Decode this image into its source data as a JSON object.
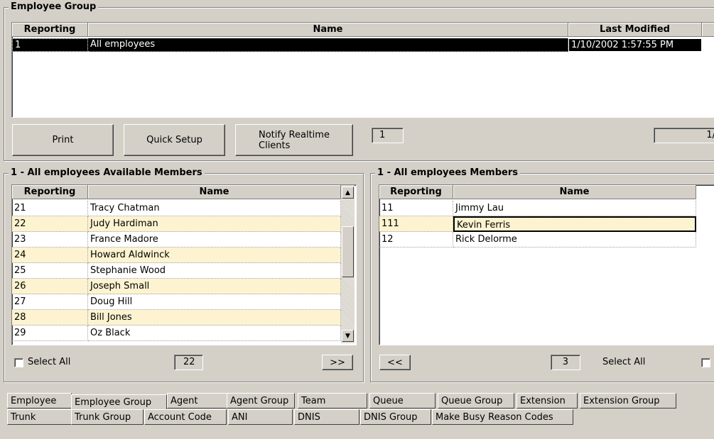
{
  "employee_group": {
    "title": "Employee Group",
    "columns": [
      "Reporting",
      "Name",
      "Last Modified"
    ],
    "rows": [
      {
        "reporting": "1",
        "name": "All employees",
        "modified": "1/10/2002 1:57:55 PM"
      }
    ]
  },
  "buttons": {
    "print": "Print",
    "quick_setup": "Quick Setup",
    "notify": "Notify Realtime Clients"
  },
  "counters": {
    "group_count": "1",
    "group_pos": "1/",
    "available_count": "22",
    "members_count": "3"
  },
  "available": {
    "title": "1 - All employees Available Members",
    "columns": [
      "Reporting",
      "Name"
    ],
    "rows": [
      {
        "reporting": "21",
        "name": "Tracy Chatman"
      },
      {
        "reporting": "22",
        "name": "Judy Hardiman"
      },
      {
        "reporting": "23",
        "name": "France Madore"
      },
      {
        "reporting": "24",
        "name": "Howard Aldwinck"
      },
      {
        "reporting": "25",
        "name": "Stephanie Wood"
      },
      {
        "reporting": "26",
        "name": "Joseph Small"
      },
      {
        "reporting": "27",
        "name": "Doug Hill"
      },
      {
        "reporting": "28",
        "name": "Bill Jones"
      },
      {
        "reporting": "29",
        "name": "Oz Black"
      }
    ],
    "select_all": "Select All",
    "move_right": ">>"
  },
  "members": {
    "title": "1 - All employees Members",
    "columns": [
      "Reporting",
      "Name"
    ],
    "rows": [
      {
        "reporting": "11",
        "name": "Jimmy Lau"
      },
      {
        "reporting": "111",
        "name": "Kevin Ferris"
      },
      {
        "reporting": "12",
        "name": "Rick Delorme"
      }
    ],
    "select_all": "Select All",
    "move_left": "<<"
  },
  "tabs_row1": [
    "Employee",
    "Employee Group",
    "Agent",
    "Agent Group",
    "Team",
    "Queue",
    "Queue Group",
    "Extension",
    "Extension Group"
  ],
  "tabs_row2": [
    "Trunk",
    "Trunk Group",
    "Account Code",
    "ANI",
    "DNIS",
    "DNIS Group",
    "Make Busy Reason Codes"
  ],
  "colors": {
    "background": "#d4d0c8",
    "row_alt": "#fdf3d0",
    "selected_row": "#000000"
  }
}
